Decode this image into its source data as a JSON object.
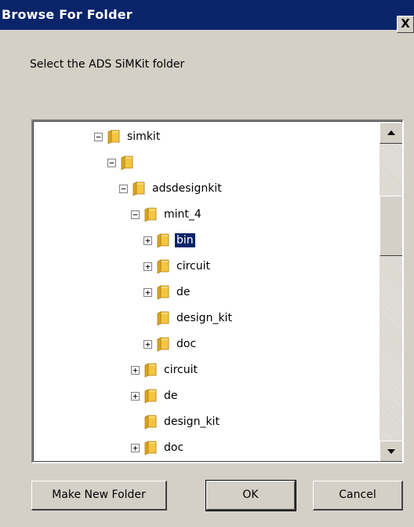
{
  "window": {
    "title": "Browse For Folder",
    "close_label": "X"
  },
  "prompt": "Select the ADS SiMKit folder",
  "tree": [
    {
      "label": "simkit",
      "expander": "minus",
      "level": 0,
      "selected": false
    },
    {
      "label": "",
      "expander": "minus",
      "level": 1,
      "selected": false
    },
    {
      "label": "adsdesignkit",
      "expander": "minus",
      "level": 2,
      "selected": false
    },
    {
      "label": "mint_4",
      "expander": "minus",
      "level": 3,
      "selected": false
    },
    {
      "label": "bin",
      "expander": "plus",
      "level": 4,
      "selected": true
    },
    {
      "label": "circuit",
      "expander": "plus",
      "level": 4,
      "selected": false
    },
    {
      "label": "de",
      "expander": "plus",
      "level": 4,
      "selected": false
    },
    {
      "label": "design_kit",
      "expander": "none",
      "level": 4,
      "selected": false
    },
    {
      "label": "doc",
      "expander": "plus",
      "level": 4,
      "selected": false
    },
    {
      "label": "circuit",
      "expander": "plus",
      "level": 3,
      "selected": false
    },
    {
      "label": "de",
      "expander": "plus",
      "level": 3,
      "selected": false
    },
    {
      "label": "design_kit",
      "expander": "none",
      "level": 3,
      "selected": false
    },
    {
      "label": "doc",
      "expander": "plus",
      "level": 3,
      "selected": false
    }
  ],
  "buttons": {
    "make_new_folder": "Make New Folder",
    "ok": "OK",
    "cancel": "Cancel"
  },
  "colors": {
    "titlebar": "#0a246a",
    "dialog": "#d4d0c8",
    "folder": "#f5c542",
    "selection": "#0a246a"
  }
}
